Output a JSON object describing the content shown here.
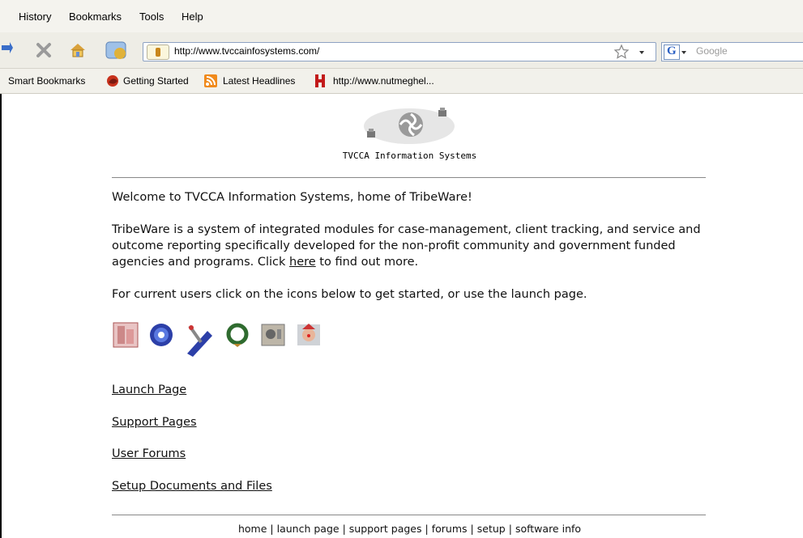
{
  "menubar": {
    "items": [
      "History",
      "Bookmarks",
      "Tools",
      "Help"
    ]
  },
  "navbar": {
    "url": "http://www.tvccainfosystems.com/",
    "search_placeholder": "Google"
  },
  "bookmarks": {
    "items": [
      "Smart Bookmarks",
      "Getting Started",
      "Latest Headlines",
      "http://www.nutmeghel..."
    ]
  },
  "page": {
    "logo_caption": "TVCCA Information Systems",
    "welcome": "Welcome to TVCCA Information Systems, home of TribeWare!",
    "intro_before_link": "TribeWare is a system of integrated modules for case-management, client tracking, and service and outcome reporting specifically developed for the non-profit community and government funded agencies and programs. Click ",
    "intro_link": "here",
    "intro_after_link": " to find out more.",
    "current_users": "For current users click on the icons below to get started, or use the launch page.",
    "links": [
      "Launch Page",
      "Support Pages",
      "User Forums",
      "Setup Documents and Files"
    ],
    "footer": [
      "home",
      "launch page",
      "support pages",
      "forums",
      "setup",
      "software info"
    ]
  },
  "colors": {
    "chrome_bg": "#f4f3ee",
    "url_border": "#8da2c2",
    "divider": "#888888"
  }
}
